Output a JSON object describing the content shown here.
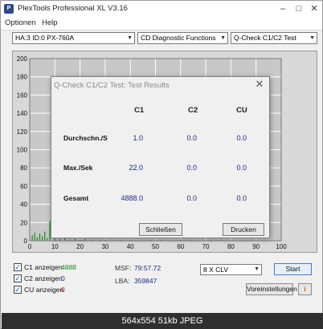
{
  "window": {
    "title": "PlexTools Professional XL V3.16"
  },
  "menu": {
    "items": [
      "Optionen",
      "Help"
    ]
  },
  "toolbar": {
    "drive": "HA:3 ID:0  PX-760A",
    "function": "CD Diagnostic Functions",
    "test": "Q-Check C1/C2 Test"
  },
  "chart_data": {
    "type": "bar",
    "y_ticks": [
      "200",
      "180",
      "160",
      "140",
      "120",
      "100",
      "80",
      "60",
      "40",
      "20",
      "0"
    ],
    "x_ticks": [
      "0",
      "10",
      "20",
      "30",
      "40",
      "50",
      "60",
      "70",
      "80",
      "90",
      "100"
    ],
    "ylim": [
      0,
      200
    ],
    "xlim": [
      0,
      100
    ],
    "grid": true,
    "series": [
      {
        "name": "C1",
        "color": "#1a8a1a",
        "x": [
          1,
          2,
          3,
          4,
          5,
          6,
          7,
          8,
          10,
          12,
          14,
          16,
          18,
          20,
          22,
          25,
          28,
          30,
          33,
          36,
          40,
          44,
          48,
          52,
          56,
          60,
          64,
          68,
          72,
          76,
          79
        ],
        "values": [
          6,
          9,
          4,
          8,
          5,
          10,
          3,
          22,
          4,
          2,
          3,
          1,
          2,
          1,
          2,
          1,
          1,
          1,
          0,
          1,
          1,
          0,
          1,
          1,
          0,
          1,
          1,
          0,
          1,
          1,
          0
        ]
      }
    ]
  },
  "dialog": {
    "title": "Q-Check C1/C2 Test: Test Results",
    "columns": [
      "C1",
      "C2",
      "CU"
    ],
    "rows": [
      {
        "label": "Durchschn./S",
        "values": [
          "1.0",
          "0.0",
          "0.0"
        ]
      },
      {
        "label": "Max./Sek",
        "values": [
          "22.0",
          "0.0",
          "0.0"
        ]
      },
      {
        "label": "Gesamt",
        "values": [
          "4888.0",
          "0.0",
          "0.0"
        ]
      }
    ],
    "close_label": "Schließen",
    "print_label": "Drucken"
  },
  "options": {
    "c1": {
      "label": "C1 anzeigen",
      "value": "4888",
      "color": "#1a8a1a"
    },
    "c2": {
      "label": "C2 anzeigen",
      "value": "0",
      "color": "#1a2a8a"
    },
    "cu": {
      "label": "CU anzeigen",
      "value": "0",
      "color": "#c02020"
    }
  },
  "info": {
    "msf_label": "MSF:",
    "msf_value": "79:57.72",
    "lba_label": "LBA:",
    "lba_value": "359847"
  },
  "speed": {
    "selected": "8 X CLV"
  },
  "buttons": {
    "start": "Start",
    "settings": "Voreinstellungen"
  },
  "footer": {
    "caption": "564x554 51kb JPEG"
  }
}
